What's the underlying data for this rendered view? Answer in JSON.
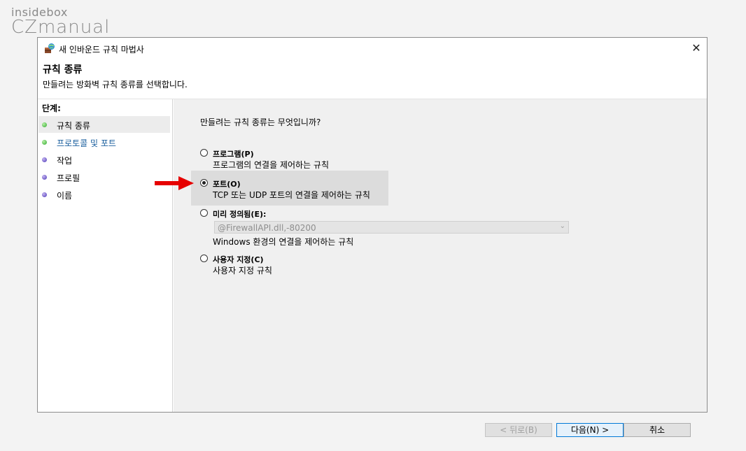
{
  "watermark": {
    "top": "insidebox",
    "bottom": "CZmanual"
  },
  "window": {
    "title": "새 인바운드 규칙 마법사",
    "close": "✕"
  },
  "header": {
    "title": "규칙 종류",
    "description": "만들려는 방화벽 규칙 종류를 선택합니다."
  },
  "steps": {
    "title": "단계:",
    "items": [
      {
        "label": "규칙 종류"
      },
      {
        "label": "프로토콜 및 포트"
      },
      {
        "label": "작업"
      },
      {
        "label": "프로필"
      },
      {
        "label": "이름"
      }
    ]
  },
  "content": {
    "question": "만들려는 규칙 종류는 무엇입니까?",
    "options": [
      {
        "label": "프로그램(P)",
        "description": "프로그램의 연결을 제어하는 규칙",
        "selected": false
      },
      {
        "label": "포트(O)",
        "description": "TCP 또는 UDP 포트의 연결을 제어하는 규칙",
        "selected": true
      },
      {
        "label": "미리 정의됨(E):",
        "description": "Windows 환경의 연결을 제어하는 규칙",
        "selected": false
      },
      {
        "label": "사용자 지정(C)",
        "description": "사용자 지정 규칙",
        "selected": false
      }
    ],
    "predefined_select": {
      "value": "@FirewallAPI.dll,-80200"
    }
  },
  "buttons": {
    "back": "< 뒤로(B)",
    "next": "다음(N) >",
    "cancel": "취소"
  },
  "colors": {
    "accent": "#0078d7",
    "arrow": "#e60000",
    "step_link": "#1a5f9e"
  }
}
